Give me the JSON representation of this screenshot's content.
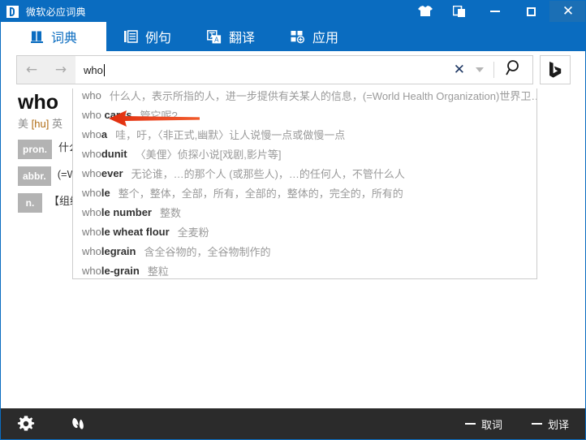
{
  "window": {
    "title": "微软必应词典",
    "logo_icon": "bing-logo-icon",
    "controls": {
      "skin_icon": "tshirt-skin-icon",
      "copy_icon": "multi-window-icon",
      "minimize_icon": "minimize-icon",
      "maximize_icon": "maximize-icon",
      "close_icon": "close-icon",
      "close_label": "✕"
    }
  },
  "tabs": [
    {
      "label": "词典",
      "icon": "book-icon",
      "active": true
    },
    {
      "label": "例句",
      "icon": "list-lines-icon",
      "active": false
    },
    {
      "label": "翻译",
      "icon": "translate-icon",
      "active": false
    },
    {
      "label": "应用",
      "icon": "apps-grid-plus-icon",
      "active": false
    }
  ],
  "search": {
    "back_icon": "arrow-left-icon",
    "back_glyph": "←",
    "forward_icon": "arrow-right-icon",
    "forward_glyph": "→",
    "value": "who",
    "placeholder": "",
    "clear_icon": "clear-x-icon",
    "clear_glyph": "✕",
    "history_icon": "chevron-down-icon",
    "search_icon": "magnifier-icon",
    "bing_button_icon": "bing-b-icon"
  },
  "annotation": {
    "arrow_icon": "red-arrow-left-icon",
    "color": "#e8401f"
  },
  "result": {
    "word": "who",
    "phonetic_prefix_us": "美",
    "phonetic_us": "[hu]",
    "phonetic_prefix_uk": "英",
    "definitions": [
      {
        "pos": "pron.",
        "text": "什么人，表示所指的人"
      },
      {
        "pos": "abbr.",
        "text": "(=World Health Organization) 世界卫生组织"
      },
      {
        "pos": "n.",
        "text": "【组织机构】世界卫生组织"
      }
    ]
  },
  "suggestions": [
    {
      "prefix": "who",
      "bold": "",
      "meaning": "什么人，表示所指的人，进一步提供有关某人的信息，(=World Health Organization)世界卫…"
    },
    {
      "prefix": "who ",
      "bold": "cares",
      "meaning": "管它呢?"
    },
    {
      "prefix": "who",
      "bold": "a",
      "meaning": "哇，吁，〈非正式,幽默〉让人说慢一点或做慢一点"
    },
    {
      "prefix": "who",
      "bold": "dunit",
      "meaning": "〈美俚〉侦探小说[戏剧,影片等]"
    },
    {
      "prefix": "who",
      "bold": "ever",
      "meaning": "无论谁，…的那个人 (或那些人)，…的任何人，不管什么人"
    },
    {
      "prefix": "who",
      "bold": "le",
      "meaning": "整个，整体，全部，所有，全部的，整体的，完全的，所有的"
    },
    {
      "prefix": "who",
      "bold": "le number",
      "meaning": "整数"
    },
    {
      "prefix": "who",
      "bold": "le wheat flour",
      "meaning": "全麦粉"
    },
    {
      "prefix": "who",
      "bold": "legrain",
      "meaning": "含全谷物的，全谷物制作的"
    },
    {
      "prefix": "who",
      "bold": "le-grain",
      "meaning": "整粒"
    }
  ],
  "footer": {
    "settings_icon": "gear-icon",
    "butterfly_icon": "butterfly-icon",
    "options": [
      {
        "label": "取词",
        "toggle_icon": "dash-toggle-icon"
      },
      {
        "label": "划译",
        "toggle_icon": "dash-toggle-icon"
      }
    ]
  },
  "colors": {
    "brand_blue": "#0a6cc0",
    "footer_dark": "#2b2b2b",
    "accent_red": "#e8401f",
    "pos_badge": "#b3b3b3"
  }
}
